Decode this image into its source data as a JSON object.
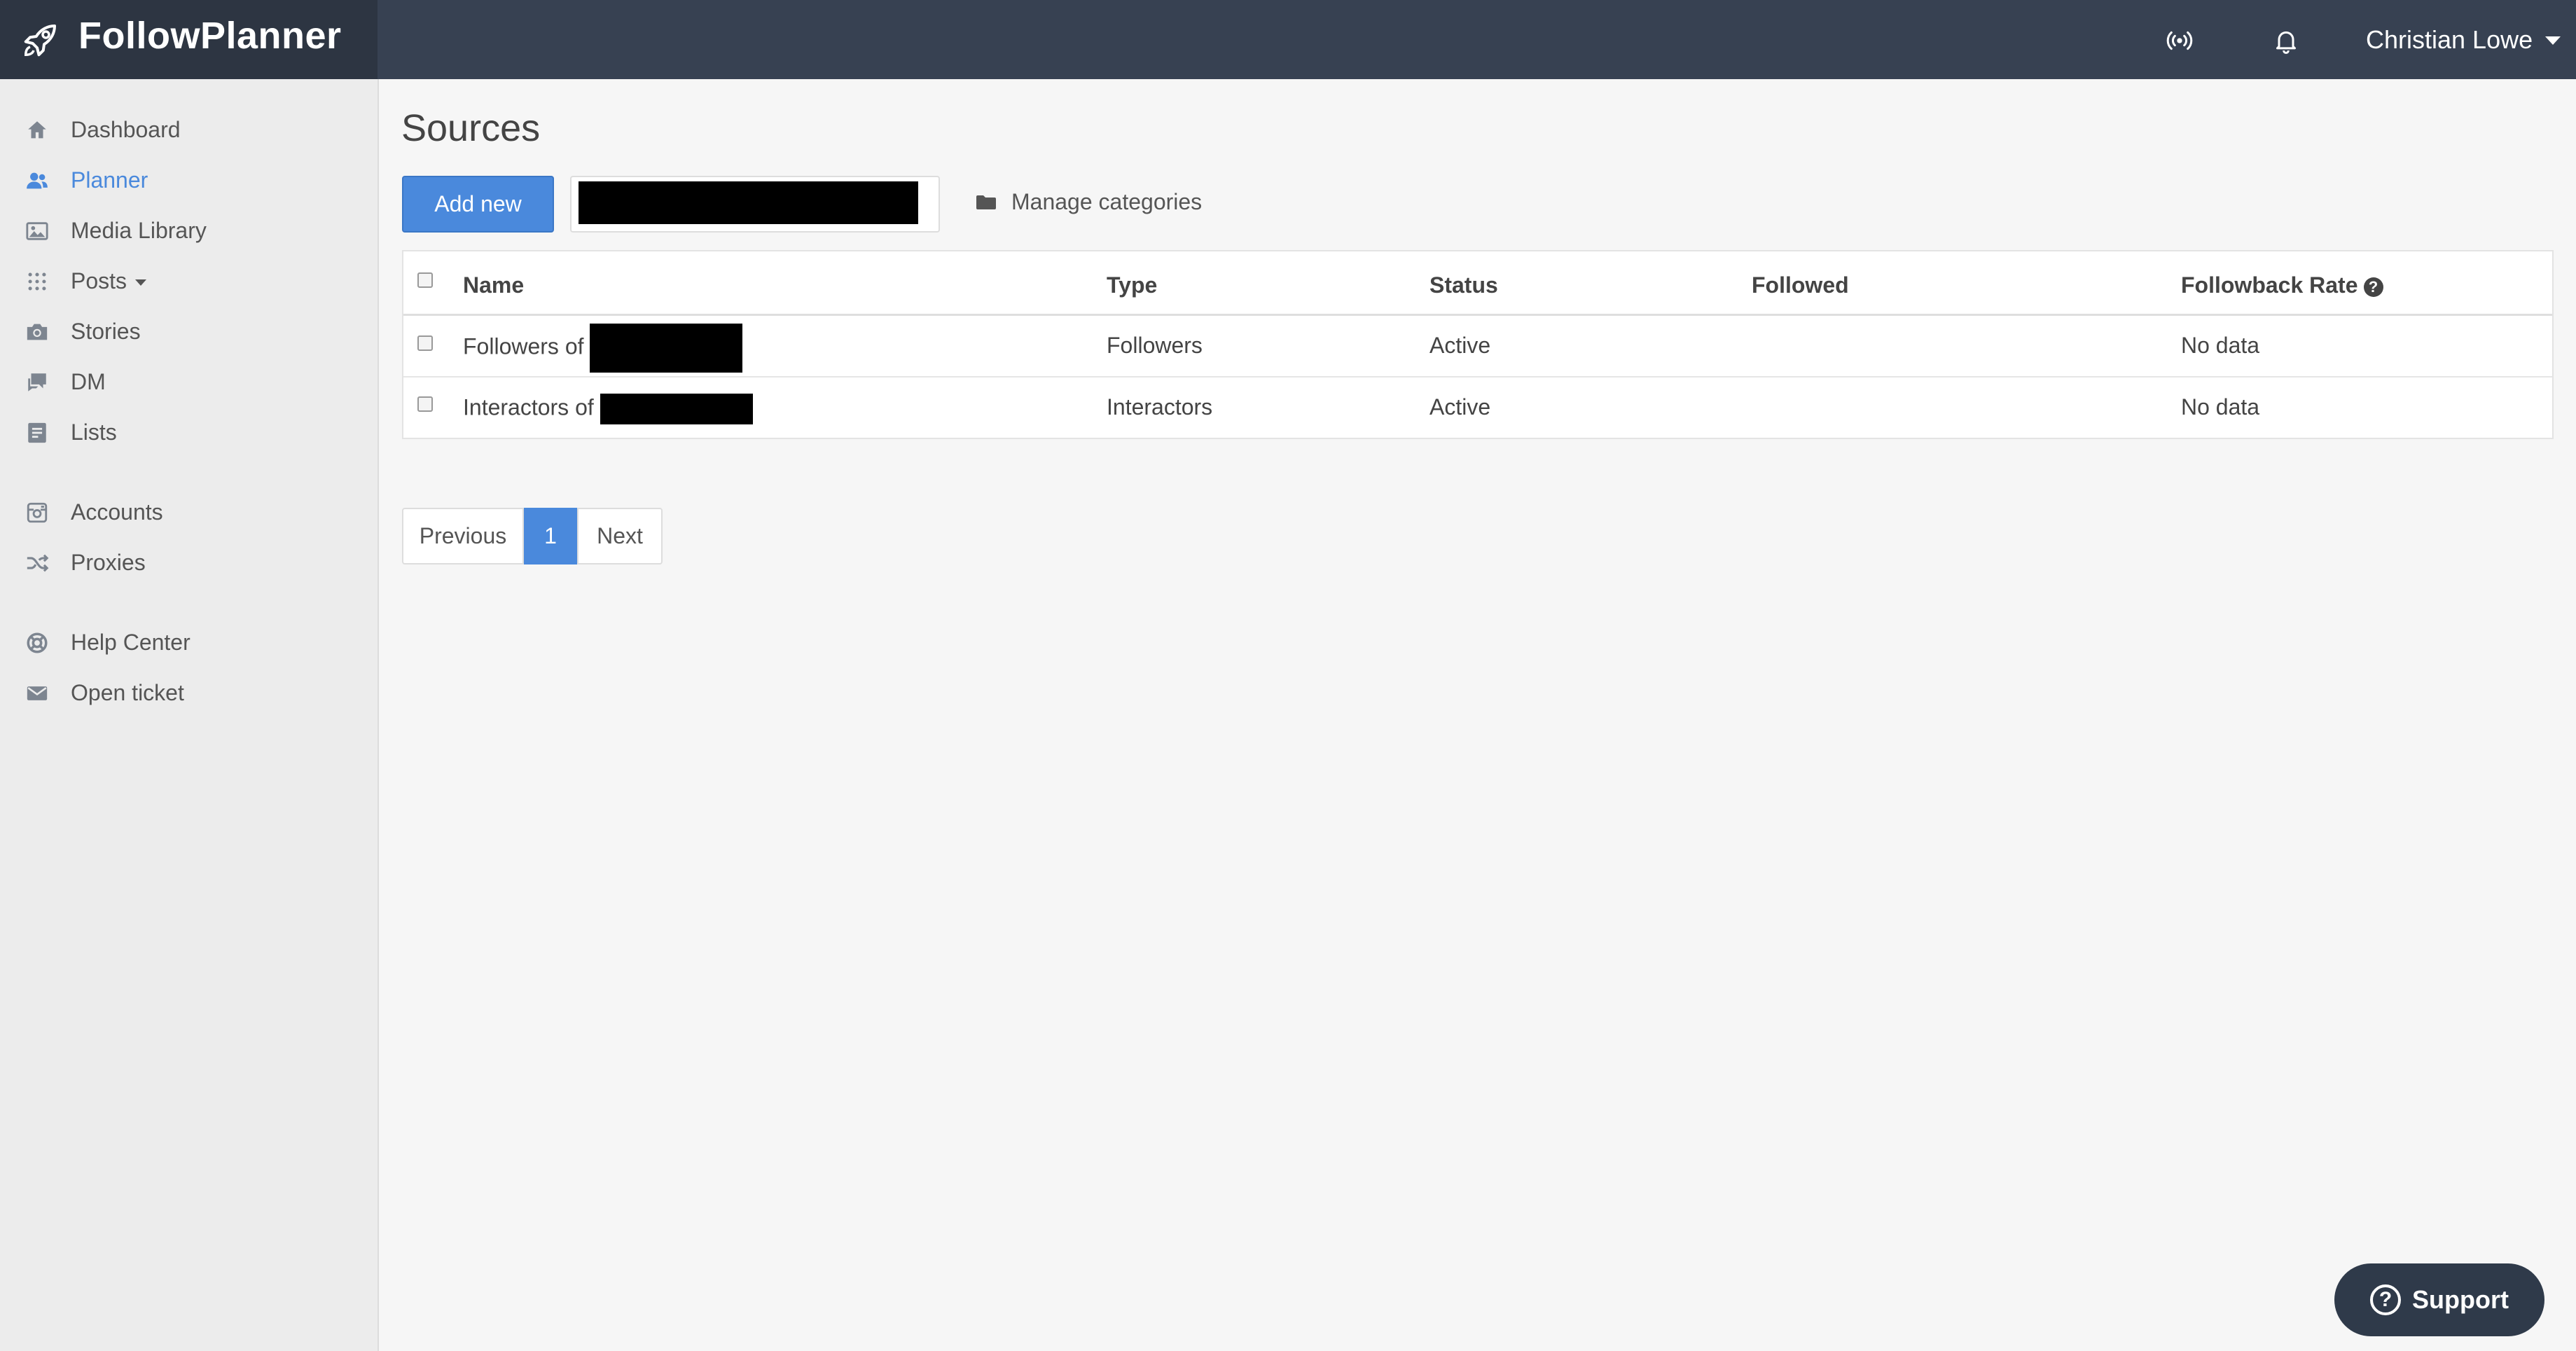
{
  "app": {
    "name": "FollowPlanner"
  },
  "header": {
    "user_name": "Christian Lowe",
    "icons": [
      "broadcast-icon",
      "bell-icon"
    ]
  },
  "sidebar": {
    "items": [
      {
        "label": "Dashboard",
        "icon": "home-icon"
      },
      {
        "label": "Planner",
        "icon": "users-icon",
        "active": true
      },
      {
        "label": "Media Library",
        "icon": "image-icon"
      },
      {
        "label": "Posts",
        "icon": "grid-icon"
      },
      {
        "label": "Stories",
        "icon": "camera-icon"
      },
      {
        "label": "DM",
        "icon": "chat-icon"
      },
      {
        "label": "Lists",
        "icon": "list-icon"
      },
      {
        "label": "Accounts",
        "icon": "instagram-icon"
      },
      {
        "label": "Proxies",
        "icon": "shuffle-icon"
      },
      {
        "label": "Help Center",
        "icon": "lifebuoy-icon"
      },
      {
        "label": "Open ticket",
        "icon": "envelope-icon"
      }
    ]
  },
  "main": {
    "title": "Sources",
    "add_button": "Add new",
    "manage_categories": "Manage categories",
    "table": {
      "headers": [
        "Name",
        "Type",
        "Status",
        "Followed",
        "Followback Rate"
      ],
      "rows": [
        {
          "name_prefix": "Followers of",
          "type": "Followers",
          "status": "Active",
          "followed": "",
          "rate": "No data"
        },
        {
          "name_prefix": "Interactors of",
          "type": "Interactors",
          "status": "Active",
          "followed": "",
          "rate": "No data"
        }
      ]
    },
    "pagination": {
      "previous": "Previous",
      "current": "1",
      "next": "Next"
    }
  },
  "support": {
    "label": "Support"
  }
}
